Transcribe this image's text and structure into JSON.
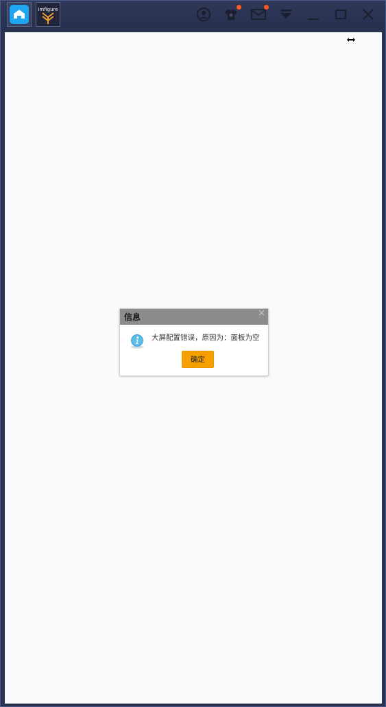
{
  "titlebar": {
    "tabs": [
      {
        "name": "home",
        "icon": "home-icon"
      },
      {
        "name": "app",
        "icon": "imfigure-app-icon",
        "logo_text": "imfigure"
      }
    ],
    "icons": [
      "account-icon",
      "tshirt-icon",
      "mail-icon",
      "dropdown-menu-icon",
      "minimize-icon",
      "maximize-icon",
      "close-icon"
    ],
    "notification_color": "#ff5a1f"
  },
  "dialog": {
    "title": "信息",
    "close_symbol": "×",
    "message": "大屏配置错误，原因为：面板为空",
    "ok_label": "确定",
    "icon": "info-icon",
    "accent": "#f5a000"
  },
  "colors": {
    "window_bg": "#2a3252",
    "content_bg": "#fafafc",
    "home_tab": "#1ea6f2"
  }
}
